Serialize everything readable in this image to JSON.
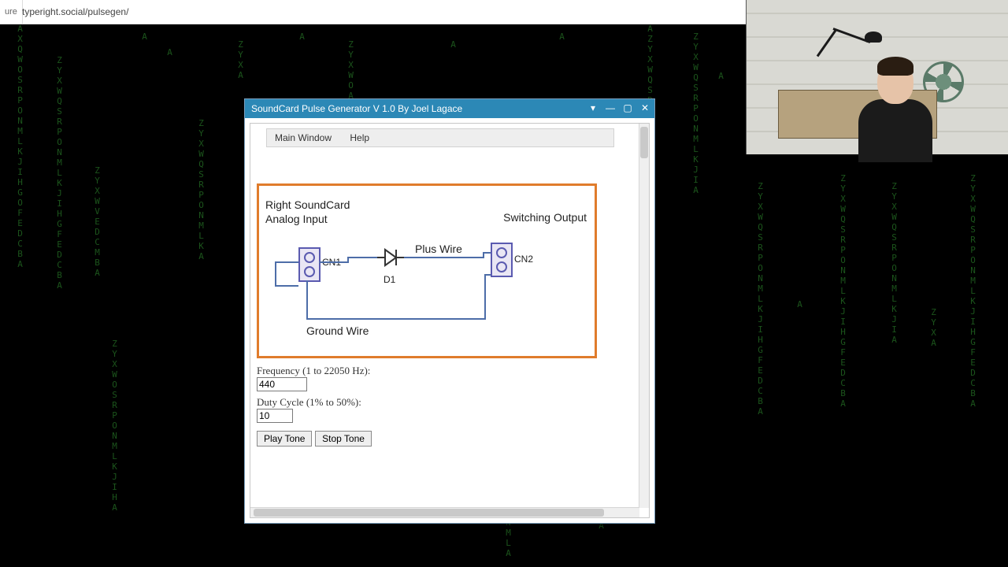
{
  "browser": {
    "secure_label": "ure",
    "url": "typeright.social/pulsegen/"
  },
  "window": {
    "title": "SoundCard Pulse Generator V 1.0 By Joel Lagace",
    "controls": {
      "pin": "▾",
      "min": "—",
      "max": "▢",
      "close": "✕"
    }
  },
  "menu": {
    "main_window": "Main Window",
    "help": "Help"
  },
  "diagram": {
    "input_label_line1": "Right SoundCard",
    "input_label_line2": "Analog Input",
    "output_label": "Switching Output",
    "cn1": "CN1",
    "cn2": "CN2",
    "d1": "D1",
    "plus_wire": "Plus Wire",
    "ground_wire": "Ground Wire"
  },
  "form": {
    "freq_label": "Frequency (1 to 22050 Hz):",
    "freq_value": "440",
    "duty_label": "Duty Cycle (1% to 50%):",
    "duty_value": "10",
    "play": "Play Tone",
    "stop": "Stop Tone"
  }
}
